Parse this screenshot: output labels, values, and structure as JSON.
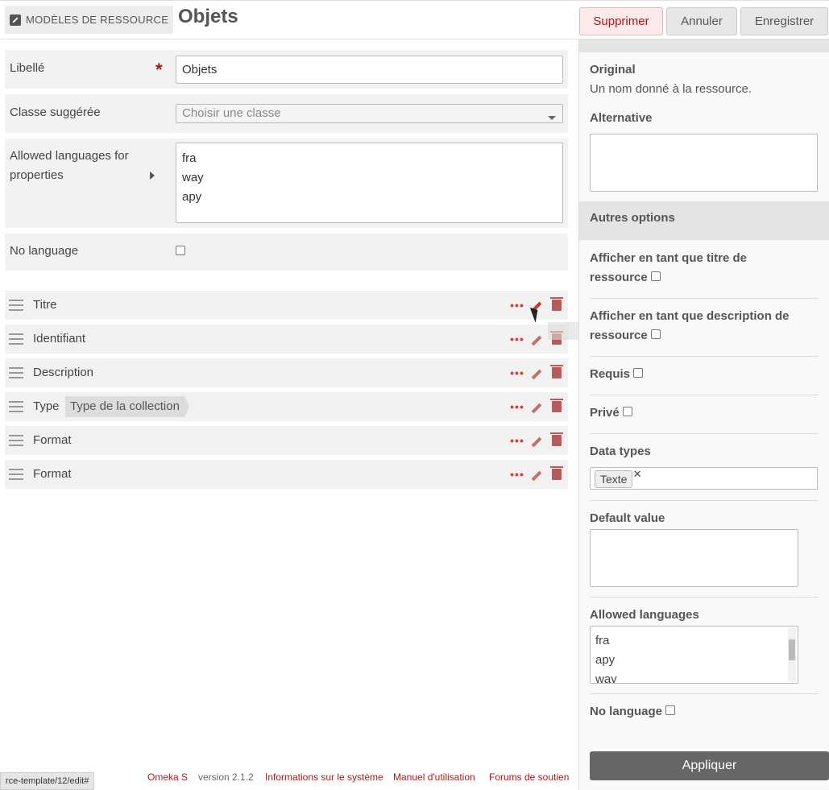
{
  "header": {
    "section_label": "Modèles de ressource",
    "title": "Objets",
    "delete_label": "Supprimer",
    "cancel_label": "Annuler",
    "save_label": "Enregistrer"
  },
  "form": {
    "label_label": "Libellé",
    "label_value": "Objets",
    "class_label": "Classe suggérée",
    "class_placeholder": "Choisir une classe",
    "allowed_languages_label": "Allowed languages for properties",
    "allowed_languages": [
      "fra",
      "way",
      "apy"
    ],
    "no_language_label": "No language"
  },
  "properties": [
    {
      "label": "Titre"
    },
    {
      "label": "Identifiant"
    },
    {
      "label": "Description"
    },
    {
      "label": "Type",
      "alt_label": "Type de la collection"
    },
    {
      "label": "Format"
    },
    {
      "label": "Format"
    }
  ],
  "sidebar": {
    "original_label": "Original",
    "original_comment": "Un nom donné à la ressource.",
    "alternative_label": "Alternative",
    "other_options_label": "Autres options",
    "title_option": "Afficher en tant que titre de ressource",
    "description_option": "Afficher en tant que description de ressource",
    "required_label": "Requis",
    "private_label": "Privé",
    "data_types_label": "Data types",
    "data_type_tag": "Texte",
    "default_value_label": "Default value",
    "allowed_languages_label": "Allowed languages",
    "allowed_languages": [
      "fra",
      "apy",
      "way"
    ],
    "no_language_label": "No language",
    "apply_label": "Appliquer"
  },
  "footer": {
    "brand": "Omeka S",
    "version": "version 2.1.2",
    "system_info": "Informations sur le système",
    "manual": "Manuel d'utilisation",
    "forums": "Forums de soutien",
    "status_url": "rce-template/12/edit#"
  },
  "colors": {
    "accent": "#a91919",
    "action_icon": "#b84a4a",
    "sidebar_bg": "#f9f9f9"
  }
}
